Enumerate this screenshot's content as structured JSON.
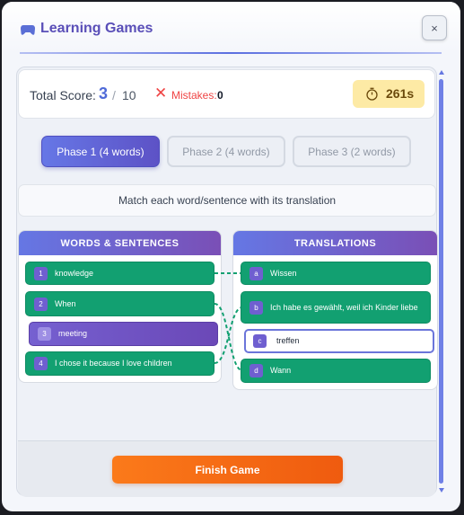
{
  "window": {
    "title": "Learning Games",
    "close_label": "×"
  },
  "score": {
    "label": "Total Score:",
    "value": "3",
    "separator": "/",
    "total": "10"
  },
  "mistakes": {
    "icon": "✕",
    "label": "Mistakes:",
    "value": "0"
  },
  "timer": {
    "icon": "stopwatch-icon",
    "value": "261s"
  },
  "phases": [
    {
      "label": "Phase 1 (4 words)",
      "active": true
    },
    {
      "label": "Phase 2 (4 words)",
      "active": false
    },
    {
      "label": "Phase 3 (2 words)",
      "active": false
    }
  ],
  "instruction": "Match each word/sentence with its translation",
  "words": {
    "header": "WORDS & SENTENCES",
    "items": [
      {
        "num": "1",
        "text": "knowledge",
        "state": "matched"
      },
      {
        "num": "2",
        "text": "When",
        "state": "matched"
      },
      {
        "num": "3",
        "text": "meeting",
        "state": "selected"
      },
      {
        "num": "4",
        "text": "I chose it because I love children",
        "state": "matched"
      }
    ]
  },
  "translations": {
    "header": "TRANSLATIONS",
    "items": [
      {
        "num": "a",
        "text": "Wissen",
        "state": "matched"
      },
      {
        "num": "b",
        "text": "Ich habe es gewählt, weil ich Kinder liebe",
        "state": "matched"
      },
      {
        "num": "c",
        "text": "treffen",
        "state": "unmatched"
      },
      {
        "num": "d",
        "text": "Wann",
        "state": "matched"
      }
    ]
  },
  "footer": {
    "finish_label": "Finish Game"
  },
  "colors": {
    "accent": "#5b6fe0",
    "matched": "#12a071",
    "selected": "#7560d0",
    "finish": "#f5670f"
  }
}
